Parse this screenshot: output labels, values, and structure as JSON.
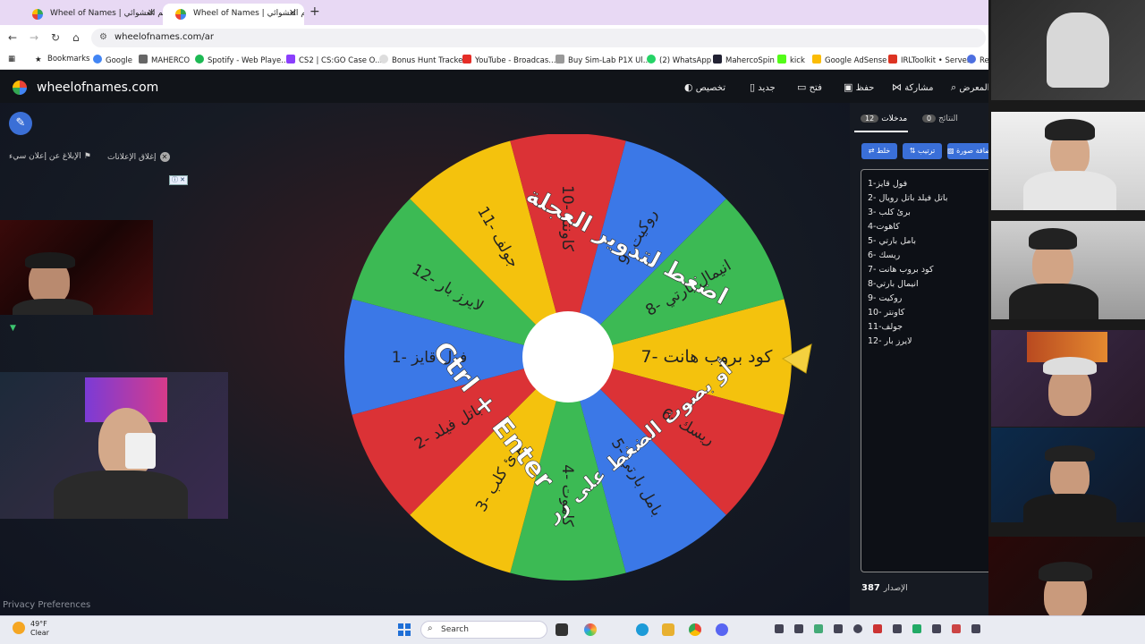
{
  "browser": {
    "tabs": [
      {
        "title": "Wheel of Names | رسم العشوائي"
      },
      {
        "title": "Wheel of Names | رسم العشوائي"
      }
    ],
    "url": "wheelofnames.com/ar",
    "bookmarks": [
      "Bookmarks",
      "Google",
      "MAHERCO",
      "Spotify - Web Playe...",
      "CS2 | CS:GO Case O...",
      "Bonus Hunt Tracker",
      "YouTube - Broadcas...",
      "Buy Sim-Lab P1X Ul...",
      "(2) WhatsApp",
      "MahercoSpin",
      "kick",
      "Google AdSense",
      "IRLToolkit • Server",
      "Res"
    ]
  },
  "site": {
    "brand": "wheelofnames.com",
    "menu": {
      "customize": "تخصيص",
      "new": "جديد",
      "open": "فتح",
      "save": "حفظ",
      "share": "مشاركة",
      "gallery": "المعرض"
    },
    "close_ads": "إغلاق الإعلانات",
    "report_ad": "الإبلاغ عن إعلان سيء",
    "ad_badge": "ⓘ ✕",
    "privacy": "Privacy Preferences"
  },
  "wheel": {
    "center_text_1": "اضغط لتدوير العجلة",
    "center_text_2": "Ctrl + Enter",
    "center_text_3": "أو بصوت الضغط على زر",
    "segments": [
      {
        "label": "كود بروب هانت -7",
        "color": "#f4c20d"
      },
      {
        "label": "ريسك -6",
        "color": "#db3236"
      },
      {
        "label": "بامل بارتي -5",
        "color": "#3b78e7"
      },
      {
        "label": "كاهوت -4",
        "color": "#3cba54"
      },
      {
        "label": "برئ كلب -3",
        "color": "#f4c20d"
      },
      {
        "label": "باتل فيلد -2",
        "color": "#db3236"
      },
      {
        "label": "فول قايز -1",
        "color": "#3b78e7"
      },
      {
        "label": "لايرز بار -12",
        "color": "#3cba54"
      },
      {
        "label": "جولف -11",
        "color": "#f4c20d"
      },
      {
        "label": "كاونتر -10",
        "color": "#db3236"
      },
      {
        "label": "روكيت -9",
        "color": "#3b78e7"
      },
      {
        "label": "انيمال بارتي -8",
        "color": "#3cba54"
      }
    ]
  },
  "panel": {
    "tab_entries": "مدخلات",
    "entries_count": "12",
    "tab_results": "النتائج",
    "results_count": "0",
    "shuffle": "خلط",
    "sort": "ترتيب",
    "add_image": "إضافة صورة",
    "entries": [
      "فول قايز-1",
      "باتل فيلد باتل رويال -2",
      "برئ كلب -3",
      "كاهوت-4",
      "بامل بارتي -5",
      "ريسك -6",
      "كود بروب هانت -7",
      "انيمال بارتي-8",
      "روكيت -9",
      "10- كاونتر",
      "جولف-11",
      "12- لايرز بار"
    ],
    "version_label": "الإصدار",
    "version": "387"
  },
  "taskbar": {
    "temp": "49°F",
    "condition": "Clear",
    "search": "Search"
  },
  "colors": {
    "accent": "#3b6fd6",
    "red": "#db3236",
    "blue": "#3b78e7",
    "green": "#3cba54",
    "yellow": "#f4c20d"
  }
}
